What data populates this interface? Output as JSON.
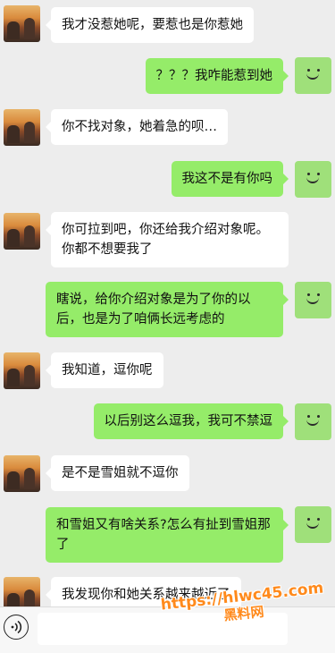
{
  "messages": [
    {
      "side": "left",
      "text": "我才没惹她呢，要惹也是你惹她"
    },
    {
      "side": "right",
      "text": "？？？我咋能惹到她"
    },
    {
      "side": "left",
      "text": "你不找对象，她着急的呗…"
    },
    {
      "side": "right",
      "text": "我这不是有你吗"
    },
    {
      "side": "left",
      "text": "你可拉到吧，你还给我介绍对象呢。你都不想要我了"
    },
    {
      "side": "right",
      "text": "瞎说，给你介绍对象是为了你的以后，也是为了咱俩长远考虑的"
    },
    {
      "side": "left",
      "text": "我知道，逗你呢"
    },
    {
      "side": "right",
      "text": "以后别这么逗我，我可不禁逗"
    },
    {
      "side": "left",
      "text": "是不是雪姐就不逗你"
    },
    {
      "side": "right",
      "text": "和雪姐又有啥关系?怎么有扯到雪姐那了"
    },
    {
      "side": "left",
      "text": "我发现你和她关系越来越近了"
    }
  ],
  "input_bar": {
    "voice_icon": "voice-icon",
    "text_value": ""
  },
  "watermark": {
    "line1": "https://hlwc45.com",
    "line2": "黑料网"
  },
  "colors": {
    "background": "#ededed",
    "bubble_right": "#95ec69",
    "bubble_left": "#ffffff",
    "watermark": "#ff8a1c"
  }
}
